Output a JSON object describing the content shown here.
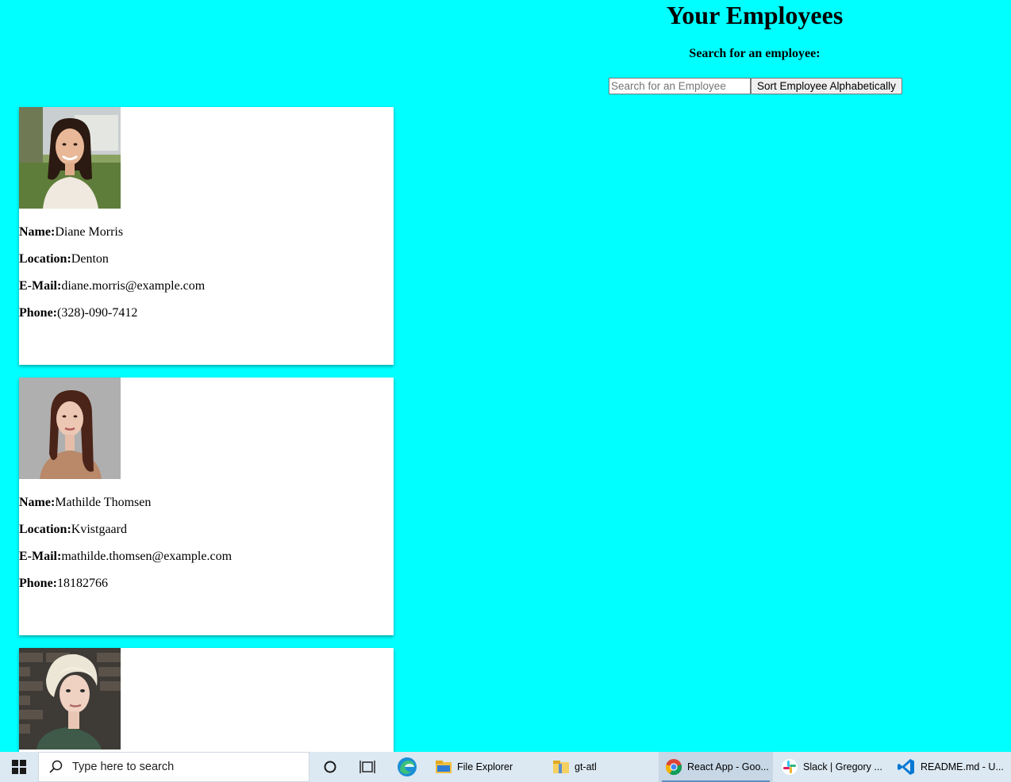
{
  "header": {
    "title": "Your Employees",
    "search_label": "Search for an employee:",
    "search_placeholder": "Search for an Employee",
    "search_value": "",
    "sort_button_label": "Sort Employee Alphabetically"
  },
  "field_labels": {
    "name": "Name:",
    "location": "Location:",
    "email": "E-Mail:",
    "phone": "Phone:"
  },
  "employees": [
    {
      "name": "Diane Morris",
      "location": "Denton",
      "email": "diane.morris@example.com",
      "phone": "(328)-090-7412",
      "photo_icon": "portrait-woman-dark-hair-outdoor"
    },
    {
      "name": "Mathilde Thomsen",
      "location": "Kvistgaard",
      "email": "mathilde.thomsen@example.com",
      "phone": "18182766",
      "photo_icon": "portrait-woman-brown-hair-gray-bg"
    },
    {
      "name": "",
      "location": "",
      "email": "",
      "phone": "",
      "photo_icon": "portrait-woman-blonde-brick-bg"
    }
  ],
  "taskbar": {
    "search_text": "Type here to search",
    "apps": [
      {
        "label": "File Explorer",
        "icon": "folder-icon"
      },
      {
        "label": "gt-atl",
        "icon": "folder-icon"
      },
      {
        "label": "React App - Goo...",
        "icon": "chrome-icon"
      },
      {
        "label": "Slack | Gregory ...",
        "icon": "slack-icon"
      },
      {
        "label": "README.md - U...",
        "icon": "vscode-icon"
      }
    ]
  }
}
